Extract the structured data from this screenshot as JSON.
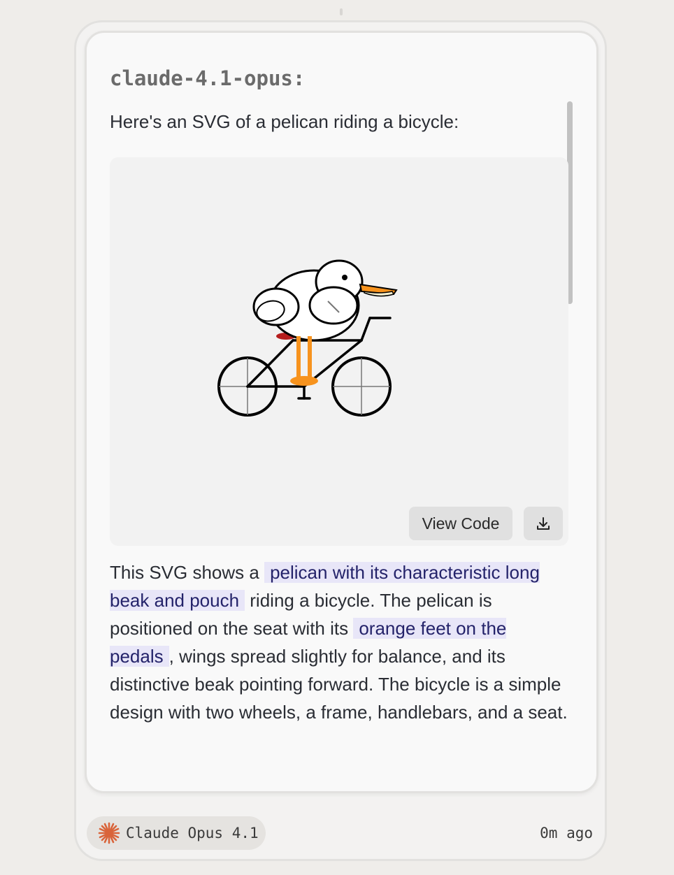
{
  "message": {
    "model_heading": "claude-4.1-opus:",
    "intro": "Here's an SVG of a pelican riding a bicycle:",
    "view_code_label": "View Code",
    "download_icon": "download-icon",
    "description": {
      "p1": "This SVG shows a ",
      "h1": "pelican with its characteristic long beak and pouch",
      "p2": " riding a bicycle. The pelican is positioned on the seat with its ",
      "h2": "orange feet on the pedals",
      "p3": ", wings spread slightly for balance, and its distinctive beak pointing forward. The bicycle is a simple design with two wheels, a frame, handlebars, and a seat."
    }
  },
  "footer": {
    "model_badge": "Claude Opus 4.1",
    "badge_icon": "claude-star-icon",
    "timestamp": "0m ago"
  },
  "colors": {
    "accent_orange": "#f7931e",
    "highlight_bg": "#e8e6f8",
    "highlight_text": "#24236a",
    "claude_star": "#d9643a"
  }
}
